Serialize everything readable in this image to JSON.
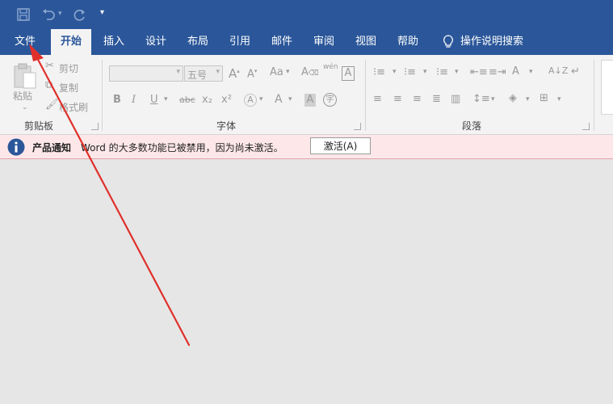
{
  "quick_access": {
    "save_icon": "save-icon",
    "undo_icon": "undo-icon",
    "redo_icon": "redo-icon",
    "customize_icon": "customize-qat-icon"
  },
  "tabs": [
    {
      "label": "文件"
    },
    {
      "label": "开始"
    },
    {
      "label": "插入"
    },
    {
      "label": "设计"
    },
    {
      "label": "布局"
    },
    {
      "label": "引用"
    },
    {
      "label": "邮件"
    },
    {
      "label": "审阅"
    },
    {
      "label": "视图"
    },
    {
      "label": "帮助"
    }
  ],
  "tell_me": {
    "label": "操作说明搜索"
  },
  "clipboard": {
    "paste_label": "粘贴",
    "cut_label": "剪切",
    "copy_label": "复制",
    "format_painter_label": "格式刷",
    "group_label": "剪贴板"
  },
  "font": {
    "font_size_value": "五号",
    "case_label": "Aa",
    "phonetic_label": "wén",
    "group_label": "字体",
    "bold": "B",
    "italic": "I",
    "underline": "U",
    "strikethrough": "abc",
    "subscript": "x₂",
    "superscript": "x²",
    "text_effects": "A",
    "font_color": "A",
    "char_shading": "A",
    "enclose": "字"
  },
  "paragraph": {
    "group_label": "段落"
  },
  "notice": {
    "title": "产品通知",
    "message": "Word 的大多数功能已被禁用，因为尚未激活。",
    "button": "激活(A)"
  },
  "colors": {
    "titlebar": "#2b579a",
    "ribbon": "#f3f3f3",
    "notice_bg": "#fde7e9",
    "info_icon": "#2b579a",
    "arrow": "#e0302a"
  }
}
